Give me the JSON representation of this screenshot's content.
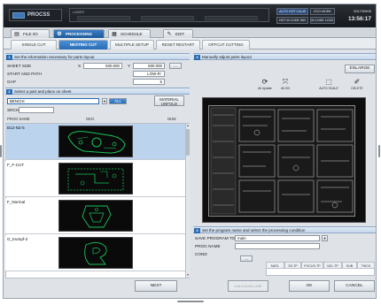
{
  "app": {
    "logo_text": "PROCSS"
  },
  "top": {
    "laser_label": "LASER",
    "status": {
      "auto_hot_calib": "AUTO HOT CALIB",
      "eco_mode": "ECO MODE",
      "hot_m_code_inh": "HOT M CODE INH",
      "m_code_lock": "M CODE LOCK"
    },
    "date": "2017/09/05",
    "time": "13:56:17"
  },
  "main_tabs": [
    {
      "label": "FILE I/O",
      "icon": "folder-icon",
      "active": false
    },
    {
      "label": "PROCESSING",
      "icon": "gear-icon",
      "active": true
    },
    {
      "label": "SCHEDULE",
      "icon": "calendar-icon",
      "active": false
    },
    {
      "label": "EDIT",
      "icon": "pencil-icon",
      "active": false
    }
  ],
  "sub_tabs": [
    {
      "label": "SINGLE CUT",
      "active": false
    },
    {
      "label": "NESTING CUT",
      "active": true
    },
    {
      "label": "MULTIPLE SETUP",
      "active": false
    },
    {
      "label": "RESET RESTART",
      "active": false
    },
    {
      "label": "OFFCUT CUTTING",
      "active": false
    }
  ],
  "section1": {
    "num": "1",
    "title": "Set the information necessary for parts layout",
    "sheet_size_label": "SHEET SIZE",
    "x_label": "X",
    "x_value": "500.000",
    "y_label": "Y",
    "y_value": "500.000",
    "start_path_label": "START AND PATH",
    "start_path_value": "LOW-R↑",
    "gap_label": "GAP",
    "gap_value": "5",
    "more_button": "..."
  },
  "section2": {
    "num": "2",
    "title": "Select a part and place on sheet",
    "dropdown_value": "BENCHI",
    "all_button": "ALL",
    "material_unfold_button": "MATERIAL UNFOLD",
    "srch_label": "SRCH",
    "cols": {
      "prog_name": "PROG NAME",
      "geo": "GEO.",
      "num": "NUM"
    },
    "parts": [
      {
        "name": "B12-N2-5",
        "selected": true
      },
      {
        "name": "F_F-CUT",
        "selected": false
      },
      {
        "name": "F_Normal",
        "selected": false
      },
      {
        "name": "G_trumpf-2",
        "selected": false
      }
    ]
  },
  "section3": {
    "num": "3",
    "title": "Manually adjust parts layout",
    "enlarge_button": "ENLARGE",
    "icons": [
      {
        "label": "All Update",
        "icon": "refresh-icon"
      },
      {
        "label": "All ON",
        "icon": "expand-icon"
      },
      {
        "label": "AUTO SCALE",
        "icon": "autoscale-icon"
      },
      {
        "label": "DELETE",
        "icon": "delete-icon"
      }
    ]
  },
  "section4": {
    "num": "4",
    "title": "Set the program name and select the processing condition",
    "save_program_label": "SAVE PROGRAM TO",
    "save_program_value": "main",
    "prog_name_label": "PROG NAME",
    "cond_label": "COND",
    "cond_button": "...",
    "table_cols": [
      "MATL",
      "SS-TP",
      "FOCUS-TP",
      "NZL-TP",
      "SUB",
      "THICK"
    ]
  },
  "bottom": {
    "nest_button": "NEST",
    "calculation_button": "CALCULAN LINE",
    "ok_button": "OK",
    "cancel_button": "CANCEL"
  }
}
